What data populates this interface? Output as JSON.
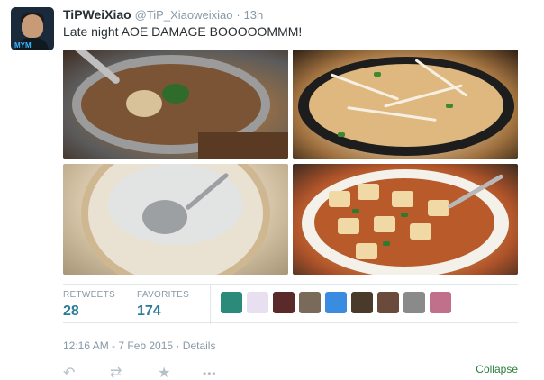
{
  "tweet": {
    "fullname": "TiPWeiXiao",
    "username": "@TiP_Xiaoweixiao",
    "separator": "·",
    "time_ago": "13h",
    "text": "Late night AOE DAMAGE BOOOOOMMM!",
    "avatar_logo": "MYM"
  },
  "stats": {
    "retweets_label": "RETWEETS",
    "retweets_value": "28",
    "favorites_label": "FAVORITES",
    "favorites_value": "174",
    "favoriter_colors": [
      "#2c8a7a",
      "#e8e0f0",
      "#5a2a2a",
      "#7a6a5a",
      "#3a8ce0",
      "#4a3a2a",
      "#6a4a3a",
      "#8a8a8a",
      "#c0708a"
    ]
  },
  "footer": {
    "timestamp": "12:16 AM - 7 Feb 2015",
    "separator": "·",
    "details": "Details",
    "collapse": "Collapse"
  },
  "actions": {
    "reply_icon": "↶",
    "retweet_icon": "⇄",
    "favorite_icon": "★",
    "more_icon": "•••"
  },
  "colors": {
    "link": "#2a7a9a",
    "collapse": "#2d7f3c",
    "meta": "#8899a6"
  }
}
